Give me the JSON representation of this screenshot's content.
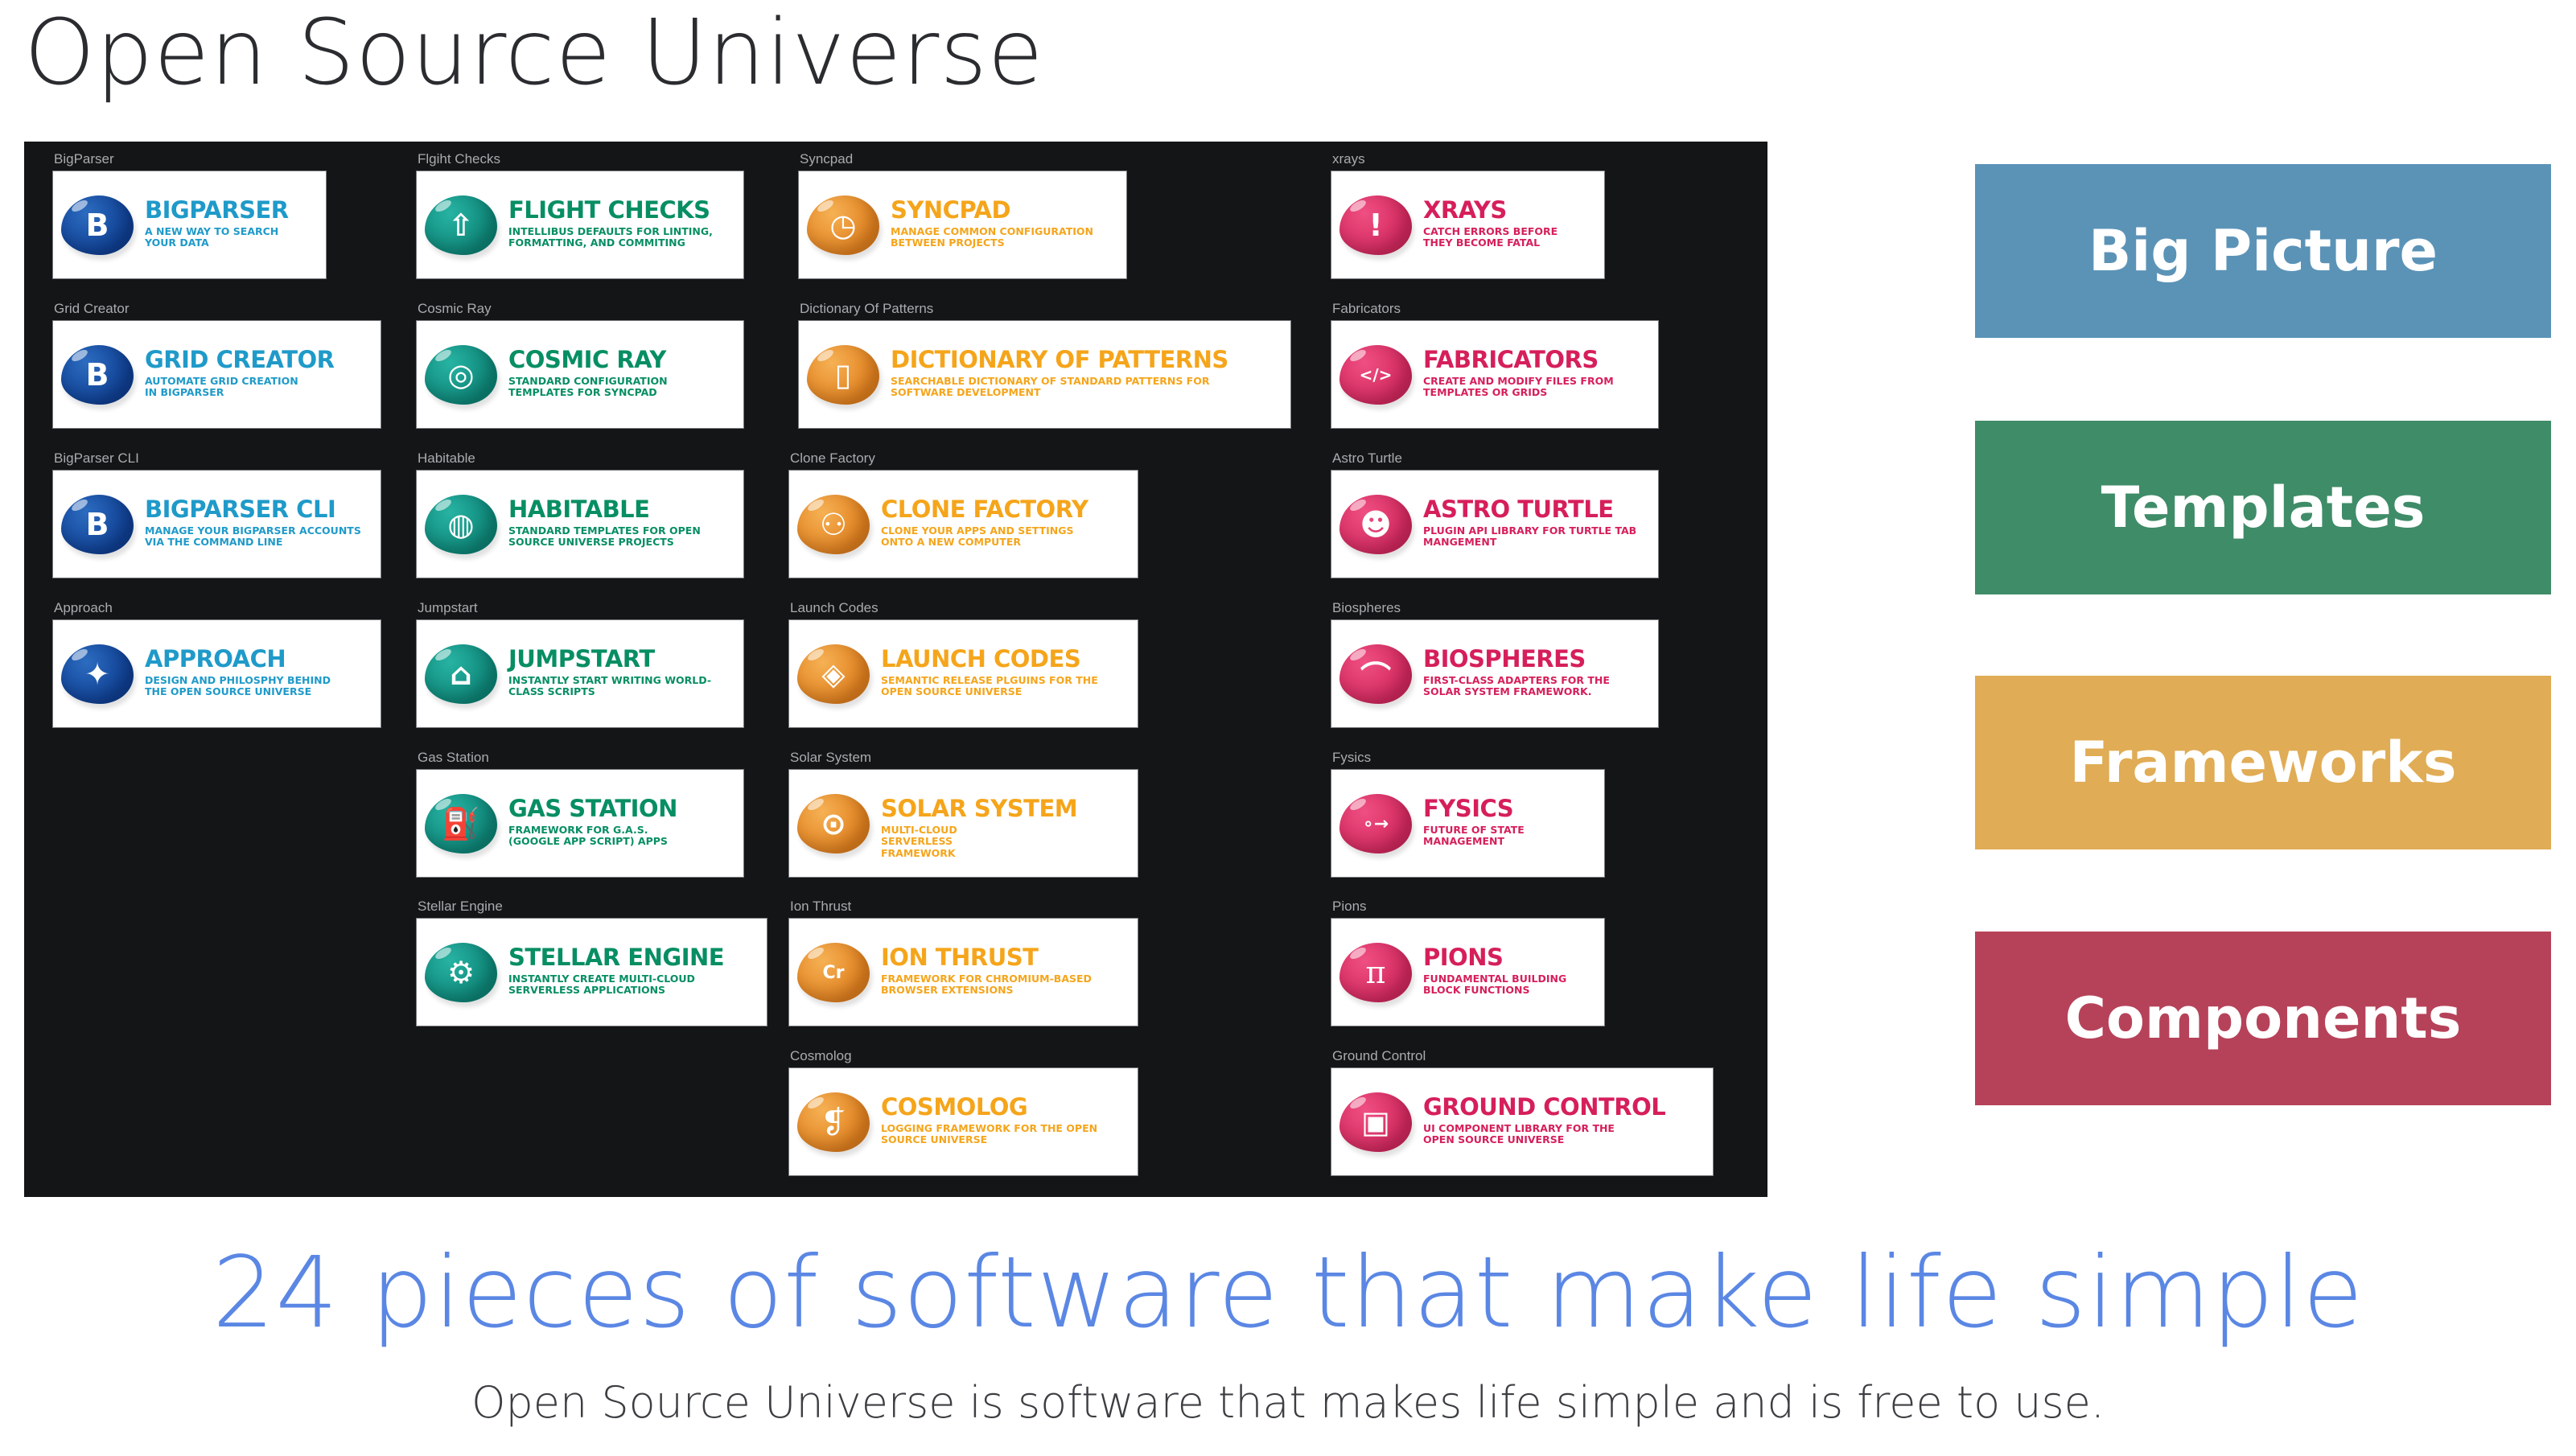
{
  "header": {
    "title": "Open Source Universe"
  },
  "projects": [
    {
      "label": "BigParser",
      "title": "BigParser",
      "description": "A new way to search your data",
      "color": "blue",
      "icon": "b-letter-icon",
      "glyph": "B"
    },
    {
      "label": "Grid Creator",
      "title": "Grid Creator",
      "description": "Automate grid creation in BigParser",
      "color": "blue",
      "icon": "b-letter-icon",
      "glyph": "B"
    },
    {
      "label": "BigParser CLI",
      "title": "BigParser CLI",
      "description": "Manage your BigParser accounts via the command line",
      "color": "blue",
      "icon": "b-letter-icon",
      "glyph": "B"
    },
    {
      "label": "Approach",
      "title": "Approach",
      "description": "Design and philosphy behind the Open Source Universe",
      "color": "blue",
      "icon": "rocket-planet-icon",
      "glyph": "✦"
    },
    {
      "label": "Flgiht Checks",
      "title": "Flight Checks",
      "description": "Intellibus defaults for linting, formatting, and commiting",
      "color": "teal",
      "icon": "rocket-tower-icon",
      "glyph": "⇧"
    },
    {
      "label": "Cosmic Ray",
      "title": "Cosmic Ray",
      "description": "Standard configuration templates for Syncpad",
      "color": "teal",
      "icon": "galaxy-icon",
      "glyph": "◎"
    },
    {
      "label": "Habitable",
      "title": "Habitable",
      "description": "Standard templates for Open Source Universe projects",
      "color": "teal",
      "icon": "globe-icon",
      "glyph": "◍"
    },
    {
      "label": "Jumpstart",
      "title": "Jumpstart",
      "description": "Instantly start writing world-class scripts",
      "color": "teal",
      "icon": "battery-box-icon",
      "glyph": "⌂"
    },
    {
      "label": "Gas Station",
      "title": "Gas Station",
      "description": "Framework for G.A.S. (Google App Script) apps",
      "color": "teal",
      "icon": "fuel-pump-icon",
      "glyph": "⛽"
    },
    {
      "label": "Stellar Engine",
      "title": "Stellar Engine",
      "description": "Instantly create multi-cloud serverless applications",
      "color": "teal",
      "icon": "engine-icon",
      "glyph": "⚙"
    },
    {
      "label": "Syncpad",
      "title": "Syncpad",
      "description": "Manage common configuration between projects",
      "color": "orange",
      "icon": "sync-dial-icon",
      "glyph": "◷"
    },
    {
      "label": "Dictionary Of Patterns",
      "title": "Dictionary of Patterns",
      "description": "Searchable dictionary of standard patterns for software development",
      "color": "orange",
      "icon": "book-search-icon",
      "glyph": "▯"
    },
    {
      "label": "Clone Factory",
      "title": "Clone Factory",
      "description": "Clone your apps and settings onto a new computer",
      "color": "orange",
      "icon": "clone-pods-icon",
      "glyph": "⚇"
    },
    {
      "label": "Launch Codes",
      "title": "Launch Codes",
      "description": "Semantic release plguins for the Open Source Universe",
      "color": "orange",
      "icon": "launch-button-icon",
      "glyph": "◈"
    },
    {
      "label": "Solar System",
      "title": "Solar System",
      "description": "Multi-cloud serverless framework",
      "color": "orange",
      "icon": "orbits-icon",
      "glyph": "⊙"
    },
    {
      "label": "Ion Thrust",
      "title": "Ion Thrust",
      "description": "Framework for Chromium-based browser extensions",
      "color": "orange",
      "icon": "ion-icon",
      "glyph": "Cr"
    },
    {
      "label": "Cosmolog",
      "title": "Cosmolog",
      "description": "Logging framework for the Open Source Universe",
      "color": "orange",
      "icon": "open-book-icon",
      "glyph": "❡"
    },
    {
      "label": "xrays",
      "title": "Xrays",
      "description": "Catch errors before they become fatal",
      "color": "pink",
      "icon": "xray-icon",
      "glyph": "!"
    },
    {
      "label": "Fabricators",
      "title": "Fabricators",
      "description": "Create and modify files from templates or grids",
      "color": "pink",
      "icon": "robot-arm-icon",
      "glyph": "</>"
    },
    {
      "label": "Astro Turtle",
      "title": "Astro Turtle",
      "description": "Plugin API library for Turtle tab mangement",
      "color": "pink",
      "icon": "turtle-icon",
      "glyph": "☻"
    },
    {
      "label": "Biospheres",
      "title": "Biospheres",
      "description": "First-class adapters for the Solar System framework.",
      "color": "pink",
      "icon": "dome-icon",
      "glyph": "⌒"
    },
    {
      "label": "Fysics",
      "title": "Fysics",
      "description": "Future of state management",
      "color": "pink",
      "icon": "state-graph-icon",
      "glyph": "∘→"
    },
    {
      "label": "Pions",
      "title": "Pions",
      "description": "Fundamental building block functions",
      "color": "pink",
      "icon": "pi-icon",
      "glyph": "π"
    },
    {
      "label": "Ground Control",
      "title": "Ground Control",
      "description": "UI component library for the Open Source Universe",
      "color": "pink",
      "icon": "monitor-user-icon",
      "glyph": "▣"
    }
  ],
  "categories": [
    {
      "label": "Big Picture",
      "color": "#5b93b7"
    },
    {
      "label": "Templates",
      "color": "#3f8c68"
    },
    {
      "label": "Frameworks",
      "color": "#e0ac55"
    },
    {
      "label": "Components",
      "color": "#b64259"
    }
  ],
  "footer": {
    "headline": "24 pieces of software that make life simple",
    "subtitle": "Open Source Universe is software that makes life simple and is free to use.",
    "headline_color": "#5b87e4"
  }
}
